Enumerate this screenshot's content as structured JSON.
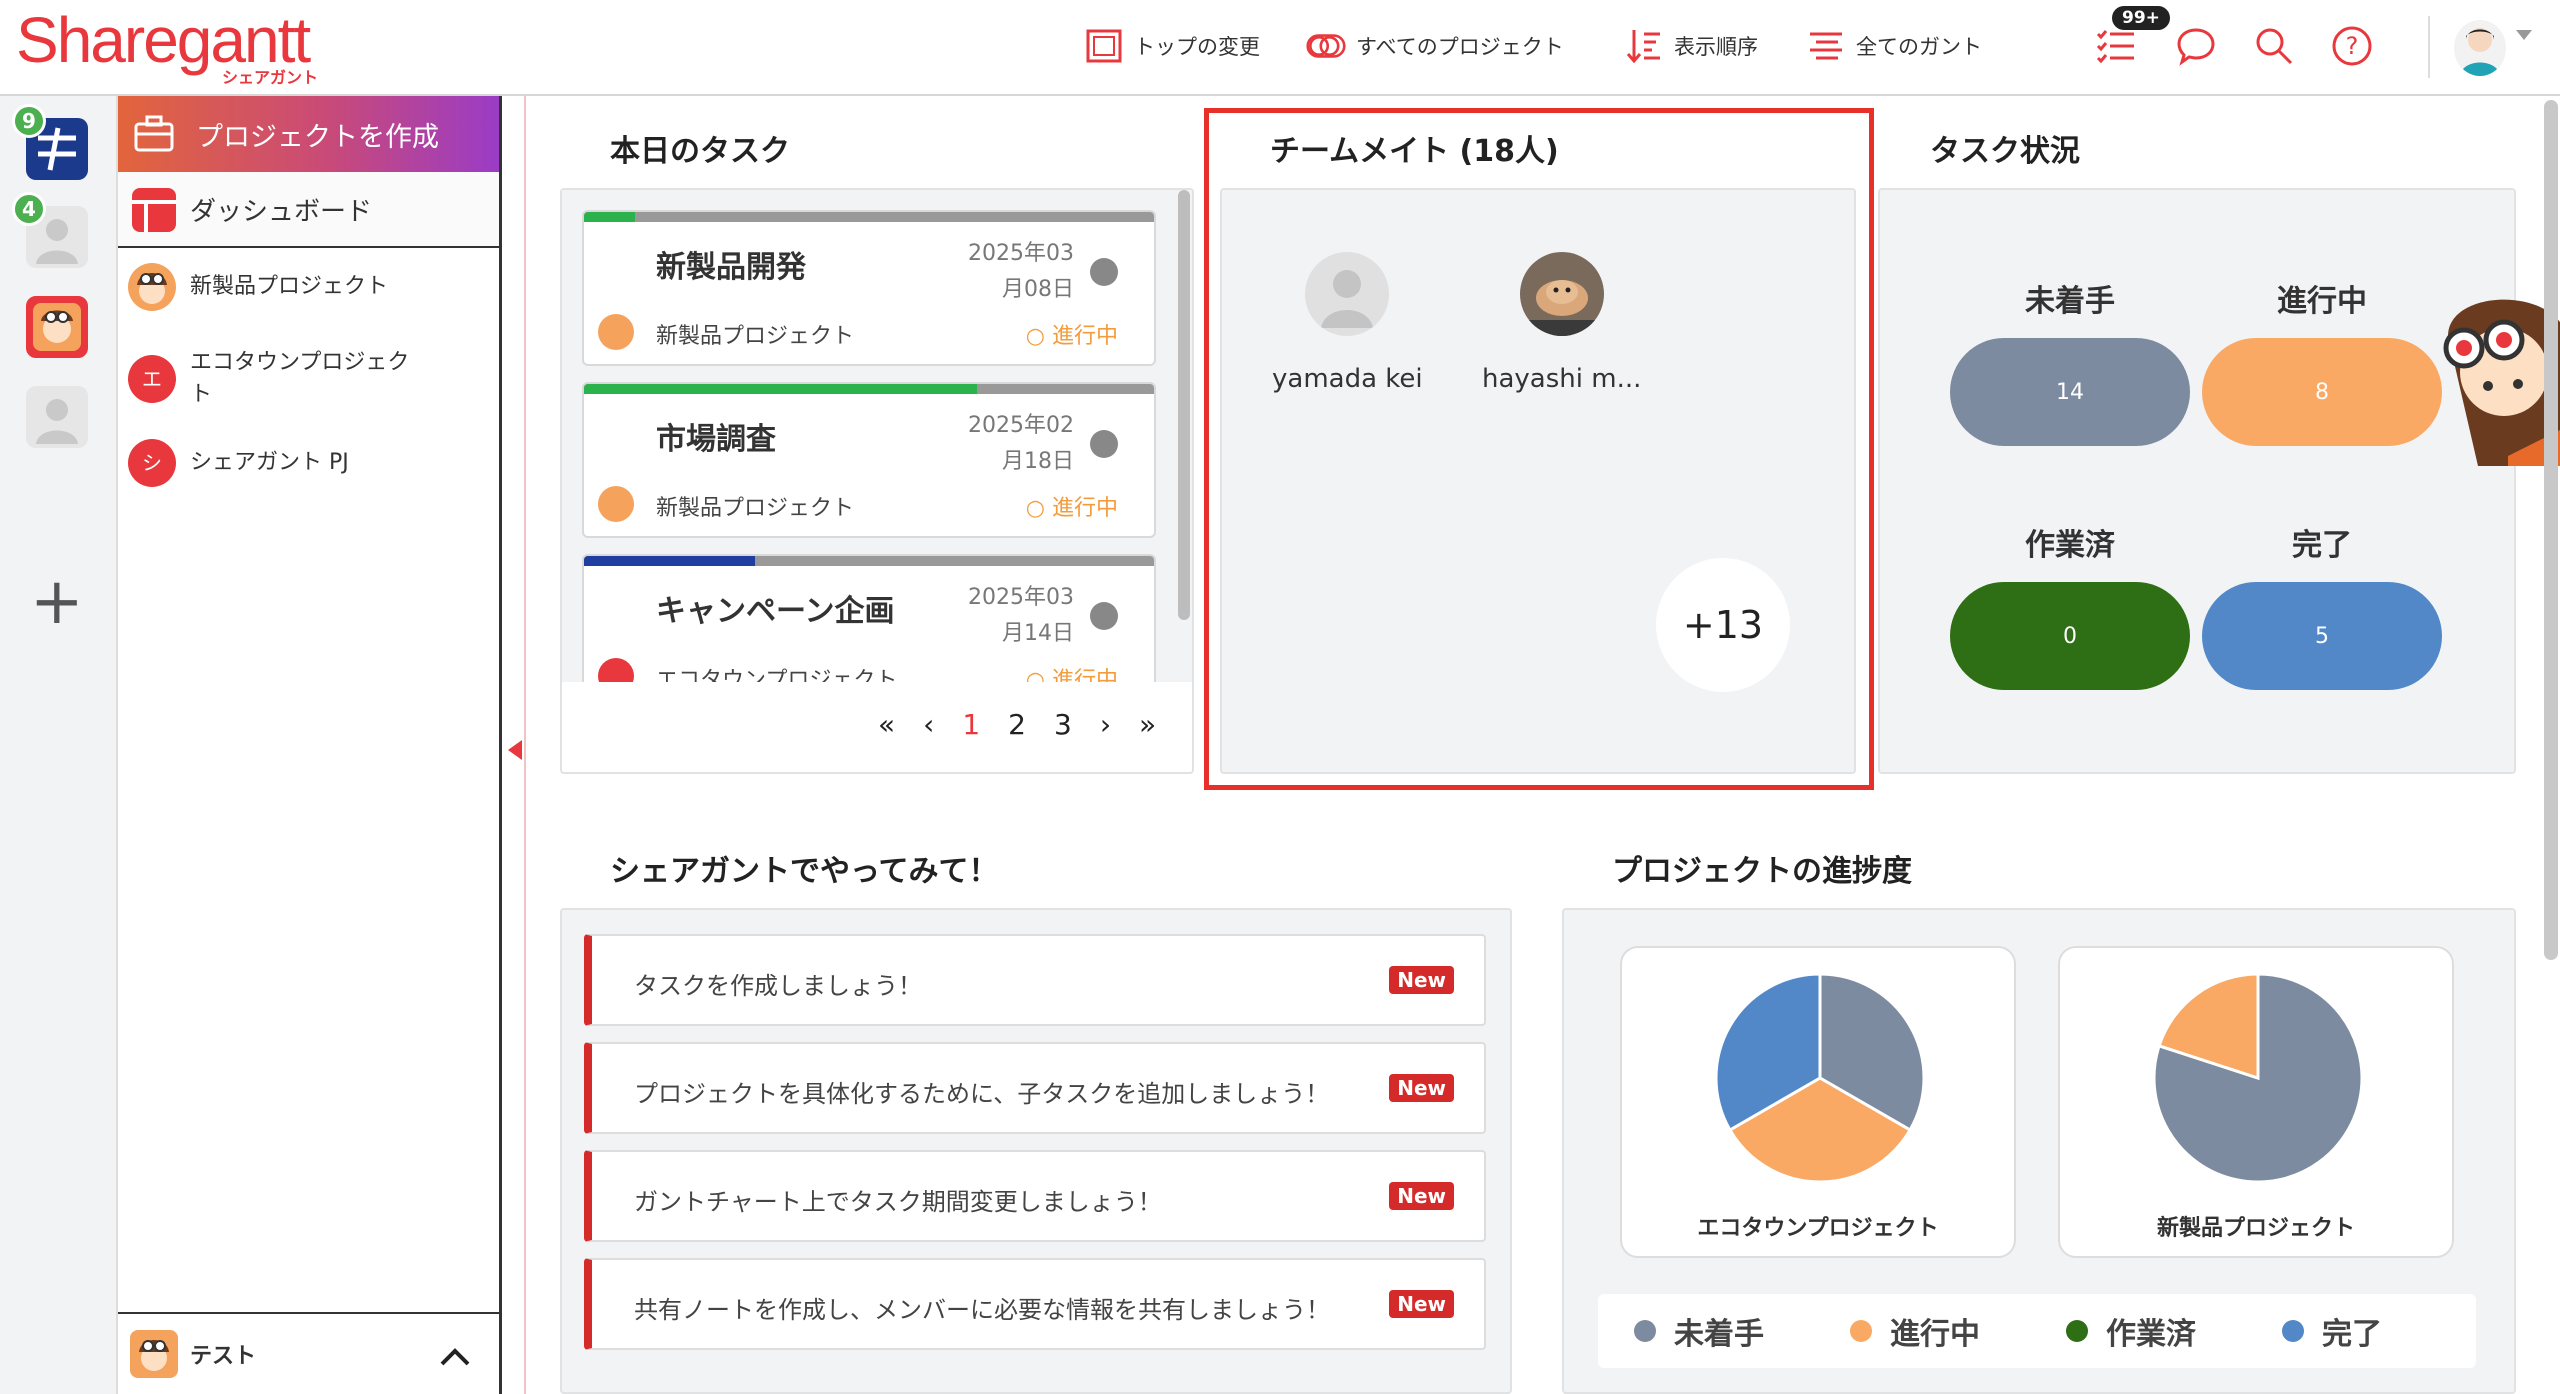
{
  "header": {
    "logo": "Sharegantt",
    "logo_sub": "シェアガント",
    "nav": [
      {
        "label": "トップの変更",
        "icon": "layout-icon"
      },
      {
        "label": "すべてのプロジェクト",
        "icon": "projects-icon"
      },
      {
        "label": "表示順序",
        "icon": "sort-icon"
      },
      {
        "label": "全てのガント",
        "icon": "gantt-icon"
      }
    ],
    "task_badge": "99+"
  },
  "rail": {
    "badges": [
      "9",
      "4"
    ]
  },
  "sidebar": {
    "create_label": "プロジェクトを作成",
    "dashboard_label": "ダッシュボード",
    "projects": [
      {
        "label": "新製品プロジェクト",
        "initial": ""
      },
      {
        "label": "エコタウンプロジェクト",
        "initial": "エ"
      },
      {
        "label": "シェアガント PJ",
        "initial": "シ"
      }
    ],
    "footer_label": "テスト"
  },
  "today_tasks": {
    "title": "本日のタスク",
    "tasks": [
      {
        "title": "新製品開発",
        "date_year": "2025年03",
        "date_day": "月08日",
        "project": "新製品プロジェクト",
        "status": "進行中",
        "progress": 0.09,
        "bar_color": "#2bb24c"
      },
      {
        "title": "市場調査",
        "date_year": "2025年02",
        "date_day": "月18日",
        "project": "新製品プロジェクト",
        "status": "進行中",
        "progress": 0.69,
        "bar_color": "#2bb24c"
      },
      {
        "title": "キャンペーン企画",
        "date_year": "2025年03",
        "date_day": "月14日",
        "project": "エコタウンプロジェクト",
        "status": "進行中",
        "progress": 0.3,
        "bar_color": "#1f3ea0"
      }
    ],
    "pager": {
      "first": "«",
      "prev": "‹",
      "pages": [
        "1",
        "2",
        "3"
      ],
      "next": "›",
      "last": "»",
      "active": "1"
    }
  },
  "teammates": {
    "title": "チームメイト (18人)",
    "members": [
      {
        "name": "yamada kei"
      },
      {
        "name": "hayashi m..."
      }
    ],
    "more": "+13"
  },
  "task_status": {
    "title": "タスク状況",
    "items": [
      {
        "label": "未着手",
        "value": "14",
        "color": "#7d8ba0"
      },
      {
        "label": "進行中",
        "value": "8",
        "color": "#f9a964"
      },
      {
        "label": "作業済",
        "value": "0",
        "color": "#2e6e14"
      },
      {
        "label": "完了",
        "value": "5",
        "color": "#5288c8"
      }
    ]
  },
  "try_it": {
    "title": "シェアガントでやってみて！",
    "new_label": "New",
    "items": [
      "タスクを作成しましょう！",
      "プロジェクトを具体化するために、子タスクを追加しましょう！",
      "ガントチャート上でタスク期間変更しましょう！",
      "共有ノートを作成し、メンバーに必要な情報を共有しましょう！"
    ]
  },
  "progress": {
    "title": "プロジェクトの進捗度",
    "legend": [
      {
        "label": "未着手",
        "color": "#7d8ba0"
      },
      {
        "label": "進行中",
        "color": "#f9a964"
      },
      {
        "label": "作業済",
        "color": "#2e6e14"
      },
      {
        "label": "完了",
        "color": "#5288c8"
      }
    ]
  },
  "chart_data": [
    {
      "type": "pie",
      "title": "エコタウンプロジェクト",
      "categories": [
        "未着手",
        "進行中",
        "作業済",
        "完了"
      ],
      "values": [
        1,
        1,
        0,
        1
      ],
      "colors": [
        "#7d8ba0",
        "#f9a964",
        "#2e6e14",
        "#5288c8"
      ]
    },
    {
      "type": "pie",
      "title": "新製品プロジェクト",
      "categories": [
        "未着手",
        "進行中",
        "作業済",
        "完了"
      ],
      "values": [
        4,
        1,
        0,
        0
      ],
      "colors": [
        "#7d8ba0",
        "#f9a964",
        "#2e6e14",
        "#5288c8"
      ]
    }
  ]
}
